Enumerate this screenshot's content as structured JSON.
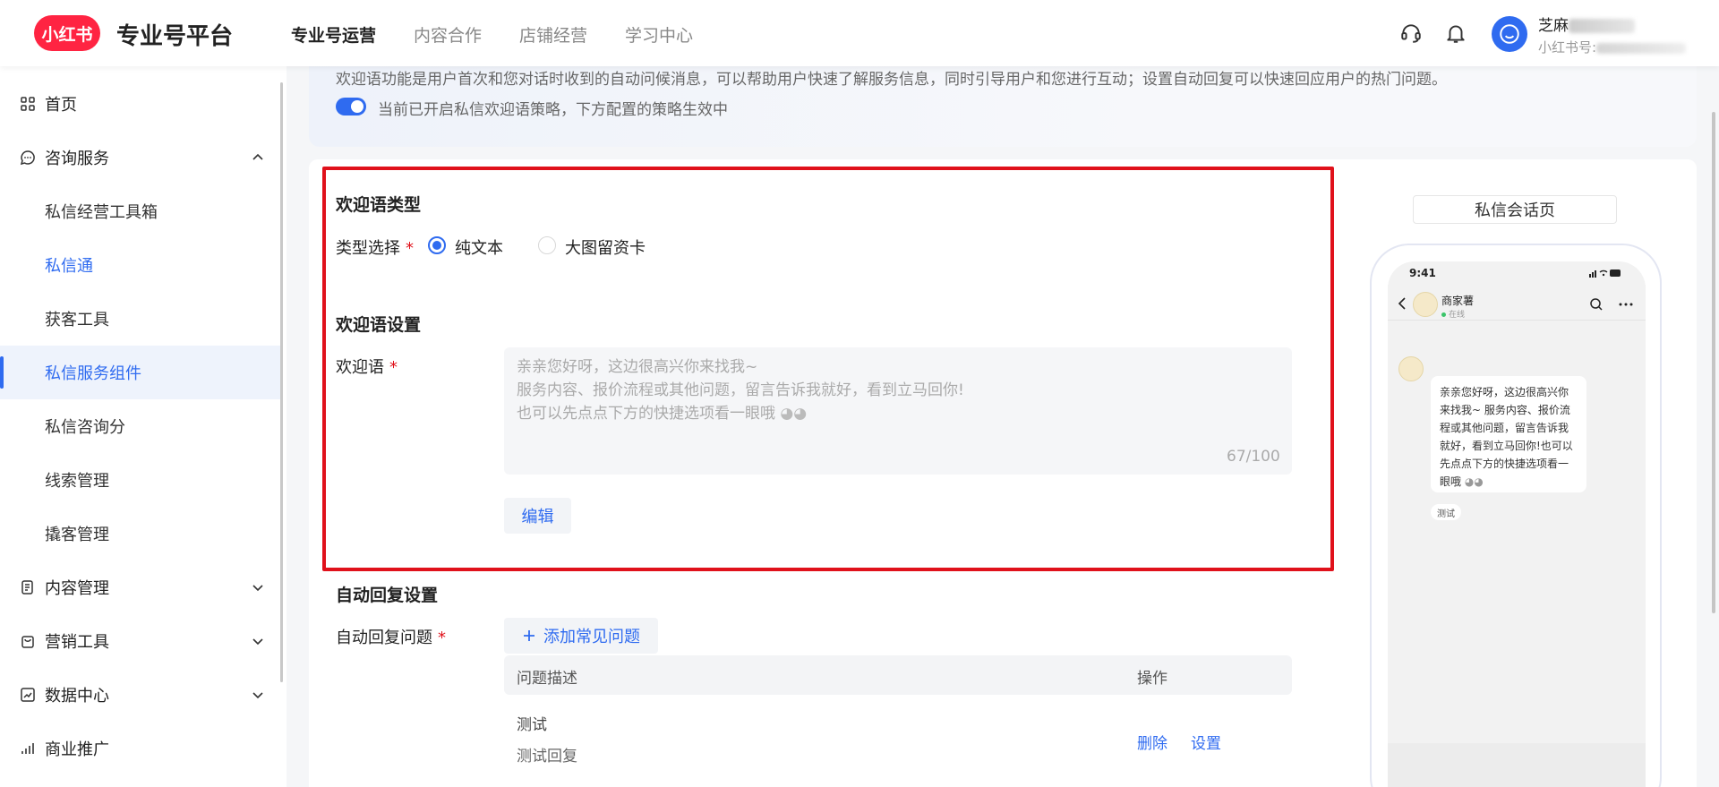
{
  "header": {
    "logo": "小红书",
    "title": "专业号平台",
    "nav": [
      "专业号运营",
      "内容合作",
      "店铺经营",
      "学习中心"
    ],
    "nav_active": 0,
    "user_name": "芝麻",
    "user_id_label": "小红书号:"
  },
  "sidebar": {
    "items": [
      {
        "label": "首页",
        "icon": "grid-icon"
      },
      {
        "label": "咨询服务",
        "icon": "chat-icon",
        "expanded": true
      },
      {
        "label": "私信经营工具箱"
      },
      {
        "label": "私信通"
      },
      {
        "label": "获客工具"
      },
      {
        "label": "私信服务组件",
        "active": true
      },
      {
        "label": "私信咨询分"
      },
      {
        "label": "线索管理"
      },
      {
        "label": "撬客管理"
      },
      {
        "label": "内容管理",
        "icon": "document-icon"
      },
      {
        "label": "营销工具",
        "icon": "bag-icon"
      },
      {
        "label": "数据中心",
        "icon": "chart-icon"
      },
      {
        "label": "商业推广",
        "icon": "signal-icon"
      }
    ]
  },
  "intro": {
    "text": "欢迎语功能是用户首次和您对话时收到的自动问候消息，可以帮助用户快速了解服务信息，同时引导用户和您进行互动；设置自动回复可以快速回应用户的热门问题。",
    "switch_text": "当前已开启私信欢迎语策略，下方配置的策略生效中"
  },
  "welcome_type": {
    "title": "欢迎语类型",
    "label": "类型选择",
    "required": "*",
    "options": [
      "纯文本",
      "大图留资卡"
    ],
    "selected": 0
  },
  "welcome_setting": {
    "title": "欢迎语设置",
    "label": "欢迎语",
    "required": "*",
    "lines": [
      "亲亲您好呀，这边很高兴你来找我~",
      "服务内容、报价流程或其他问题，留言告诉我就好，看到立马回你!",
      "也可以先点点下方的快捷选项看一眼哦"
    ],
    "count": "67/100",
    "edit_label": "编辑"
  },
  "auto_reply": {
    "title": "自动回复设置",
    "label": "自动回复问题",
    "required": "*",
    "add_label": "添加常见问题",
    "columns": [
      "问题描述",
      "操作"
    ],
    "rows": [
      {
        "question": "测试",
        "answer": "测试回复",
        "actions": [
          "删除",
          "设置"
        ]
      }
    ]
  },
  "preview": {
    "tab": "私信会话页",
    "time": "9:41",
    "name": "商家薯",
    "status": "在线",
    "bubble": "亲亲您好呀，这边很高兴你来找我~ 服务内容、报价流程或其他问题，留言告诉我就好，看到立马回你!也可以先点点下方的快捷选项看一眼哦",
    "chip": "测试"
  },
  "colors": {
    "brand": "#ff2442",
    "accent": "#2f6bf0",
    "highlight": "#e0111b"
  }
}
